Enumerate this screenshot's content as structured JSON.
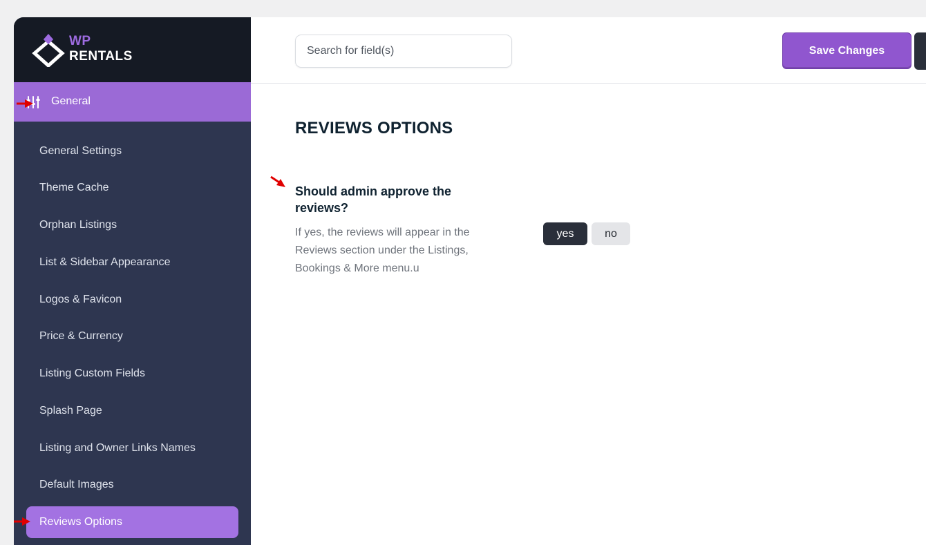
{
  "brand": {
    "line1": "WP",
    "line2": "RENTALS"
  },
  "sidebar": {
    "section": {
      "label": "General",
      "icon": "sliders-icon"
    },
    "items": [
      {
        "label": "General Settings",
        "active": false
      },
      {
        "label": "Theme Cache",
        "active": false
      },
      {
        "label": "Orphan Listings",
        "active": false
      },
      {
        "label": "List & Sidebar Appearance",
        "active": false
      },
      {
        "label": "Logos & Favicon",
        "active": false
      },
      {
        "label": "Price & Currency",
        "active": false
      },
      {
        "label": "Listing Custom Fields",
        "active": false
      },
      {
        "label": "Splash Page",
        "active": false
      },
      {
        "label": "Listing and Owner Links Names",
        "active": false
      },
      {
        "label": "Default Images",
        "active": false
      },
      {
        "label": "Reviews Options",
        "active": true
      }
    ]
  },
  "toolbar": {
    "search_placeholder": "Search for field(s)",
    "save_label": "Save Changes"
  },
  "main": {
    "title": "REVIEWS OPTIONS",
    "field": {
      "title": "Should admin approve the reviews?",
      "description": "If yes, the reviews will appear in the Reviews section under the Listings, Bookings & More menu.u",
      "options": [
        "yes",
        "no"
      ],
      "selected": "yes"
    }
  },
  "colors": {
    "accent": "#9b6ad6",
    "sidebar_bg": "#2e3650",
    "brand_bg": "#151a24",
    "annotation_arrow": "#e00000"
  }
}
